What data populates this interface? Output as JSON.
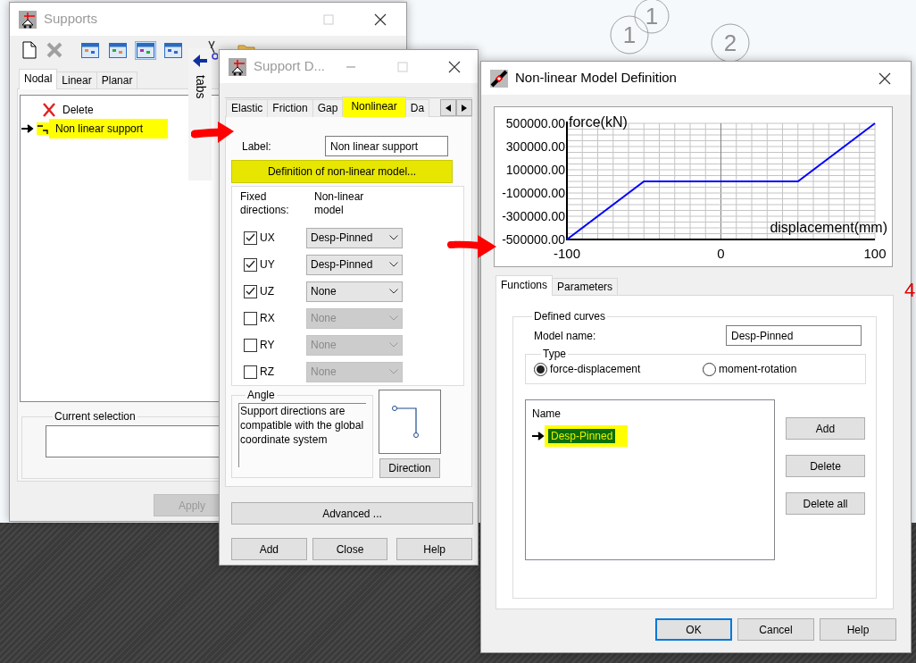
{
  "background": {
    "grid_labels": [
      "1",
      "1",
      "2"
    ],
    "edge_label": "4"
  },
  "supports": {
    "title": "Supports",
    "active": false,
    "toolbar_views": [
      {
        "selected": false
      },
      {
        "selected": false
      },
      {
        "selected": true
      },
      {
        "selected": false
      }
    ],
    "tabs": [
      {
        "label": "Nodal",
        "selected": true
      },
      {
        "label": "Linear",
        "selected": false
      },
      {
        "label": "Planar",
        "selected": false
      }
    ],
    "items": [
      {
        "label": "Delete",
        "kind": "delete",
        "current": false,
        "highlighted": false
      },
      {
        "label": "Non linear support",
        "kind": "support",
        "current": true,
        "highlighted": true
      }
    ],
    "selection_group": "Current selection",
    "apply": {
      "label": "Apply",
      "disabled": true
    }
  },
  "tabs_panel": {
    "label": "tabs"
  },
  "support_definition": {
    "title": "Support D...",
    "active": false,
    "tabs": [
      {
        "label": "Elastic",
        "selected": false,
        "highlighted": false
      },
      {
        "label": "Friction",
        "selected": false,
        "highlighted": false
      },
      {
        "label": "Gap",
        "selected": false,
        "highlighted": false
      },
      {
        "label": "Nonlinear",
        "selected": true,
        "highlighted": true
      },
      {
        "label": "Da",
        "selected": false,
        "highlighted": false
      }
    ],
    "label_field": {
      "label": "Label:",
      "value": "Non linear support"
    },
    "definition_button": {
      "label": "Definition of non-linear model...",
      "highlighted": true
    },
    "directions_header": [
      "Fixed directions:",
      "Non-linear model"
    ],
    "directions": [
      {
        "label": "UX",
        "checked": true,
        "model": "Desp-Pinned"
      },
      {
        "label": "UY",
        "checked": true,
        "model": "Desp-Pinned"
      },
      {
        "label": "UZ",
        "checked": true,
        "model": "None"
      },
      {
        "label": "RX",
        "checked": false,
        "model": "None"
      },
      {
        "label": "RY",
        "checked": false,
        "model": "None"
      },
      {
        "label": "RZ",
        "checked": false,
        "model": "None"
      }
    ],
    "angle": {
      "title": "Angle",
      "text": "Support directions are compatible with the global coordinate system"
    },
    "direction_button": "Direction",
    "advanced_button": "Advanced ...",
    "buttons": [
      "Add",
      "Close",
      "Help"
    ]
  },
  "model_definition": {
    "title": "Non-linear Model Definition",
    "active": true,
    "chart_data": {
      "type": "line",
      "xlabel": "displacement(mm)",
      "ylabel": "force(kN)",
      "x": [
        -100,
        -50,
        50,
        100
      ],
      "series": [
        {
          "color": "#0000ff",
          "values": [
            -500000,
            0,
            0,
            500000
          ]
        }
      ],
      "grid": true,
      "xlim": [
        -100,
        100
      ],
      "ylim": [
        -500000,
        500000
      ],
      "xticks": [
        -100,
        0,
        100
      ],
      "yticks": [
        {
          "value": 500000,
          "label": "500000.00"
        },
        {
          "value": 300000,
          "label": "300000.00"
        },
        {
          "value": 100000,
          "label": "100000.00"
        },
        {
          "value": -100000,
          "label": "-100000.00"
        },
        {
          "value": -300000,
          "label": "-300000.00"
        },
        {
          "value": -500000,
          "label": "-500000.00"
        }
      ]
    },
    "tabs": [
      {
        "label": "Functions",
        "selected": true
      },
      {
        "label": "Parameters",
        "selected": false
      }
    ],
    "group_title": "Defined curves",
    "model_name": {
      "label": "Model name:",
      "value": "Desp-Pinned"
    },
    "type": {
      "title": "Type",
      "options": [
        {
          "label": "force-displacement",
          "selected": true
        },
        {
          "label": "moment-rotation",
          "selected": false
        }
      ]
    },
    "curves": {
      "header": "Name",
      "items": [
        {
          "label": "Desp-Pinned",
          "selected": true,
          "current": true,
          "highlighted": true
        }
      ]
    },
    "side_buttons": [
      "Add",
      "Delete",
      "Delete all"
    ],
    "buttons": [
      {
        "label": "OK",
        "default": true
      },
      {
        "label": "Cancel",
        "default": false
      },
      {
        "label": "Help",
        "default": false
      }
    ]
  }
}
